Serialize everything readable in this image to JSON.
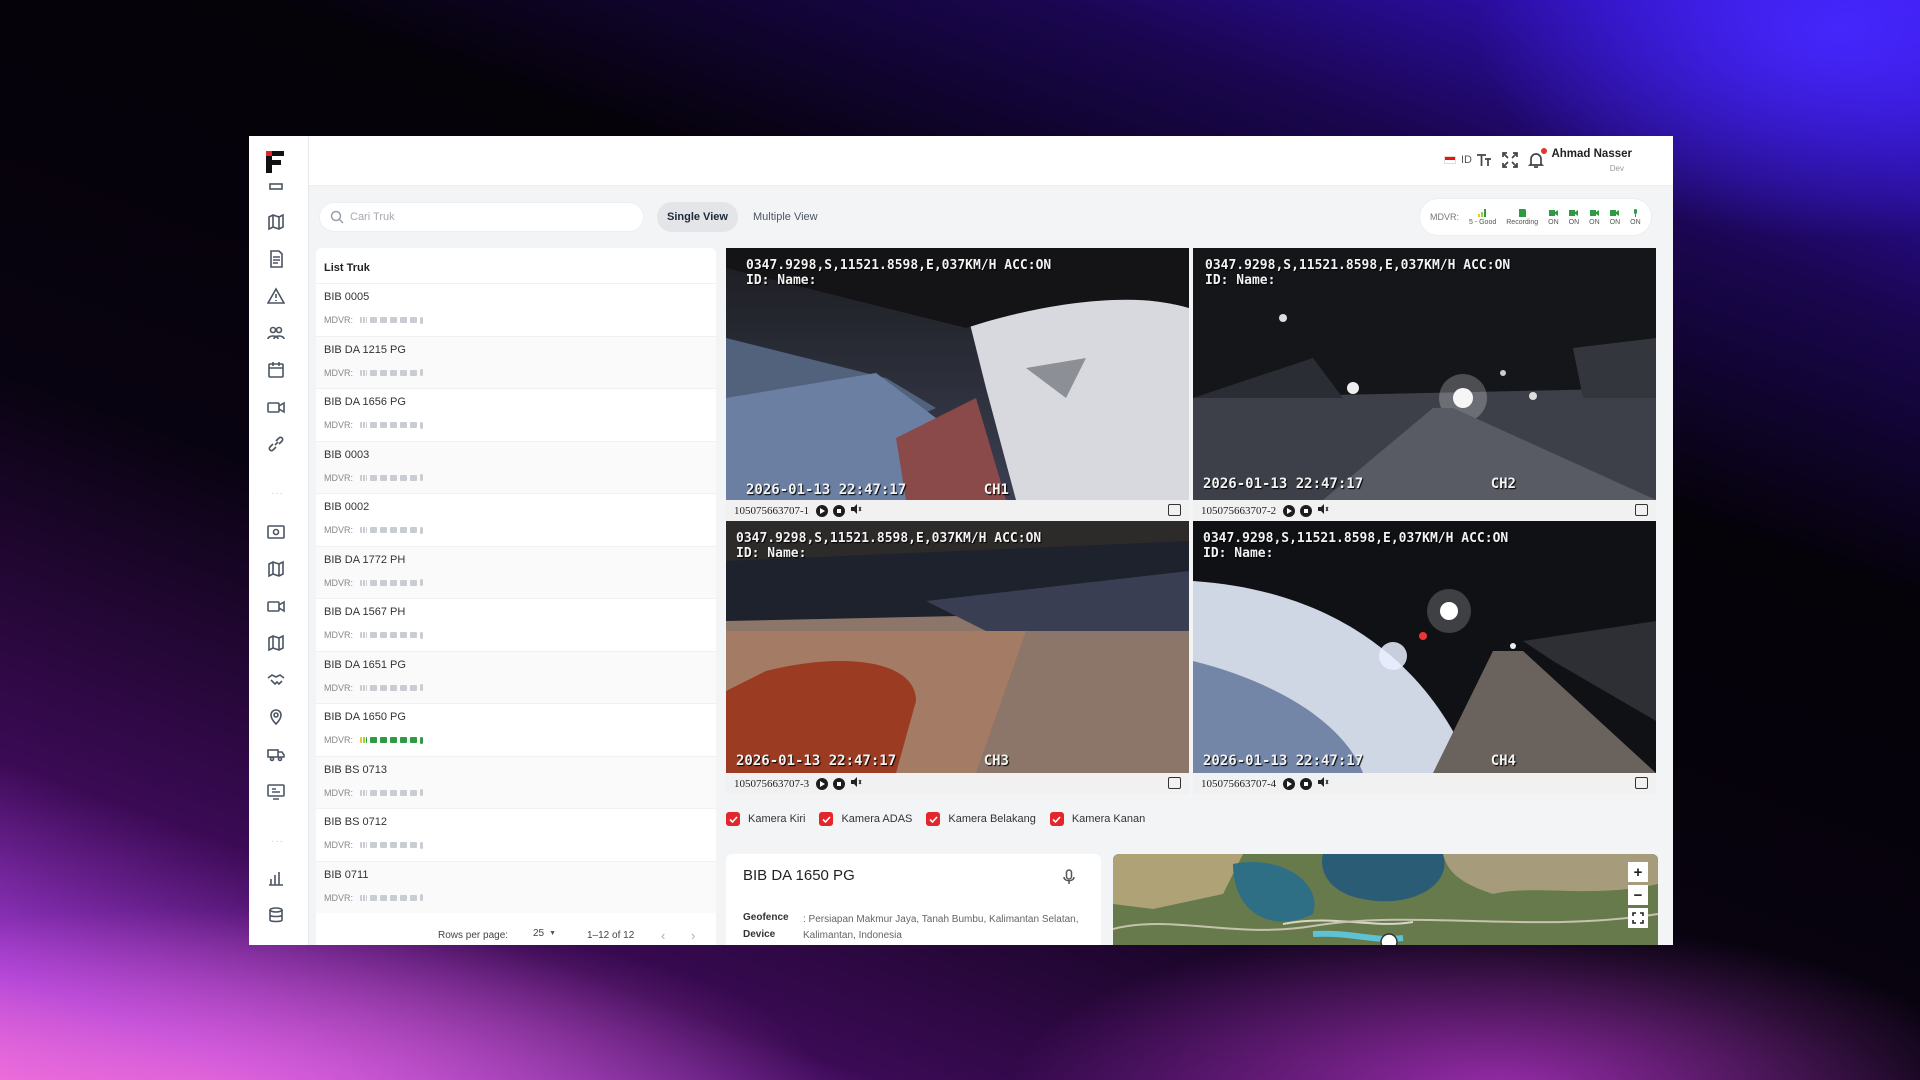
{
  "topbar": {
    "language": "ID",
    "user_name": "Ahmad Nasser",
    "user_role": "Dev"
  },
  "search": {
    "placeholder": "Cari Truk"
  },
  "views": {
    "single": "Single View",
    "multiple": "Multiple View"
  },
  "mdvr_status": {
    "label": "MDVR:",
    "items": [
      "5 - Good",
      "Recording",
      "ON",
      "ON",
      "ON",
      "ON",
      "ON"
    ]
  },
  "truck_list": {
    "title": "List Truk",
    "mdvr_label": "MDVR:",
    "items": [
      {
        "name": "BIB 0005",
        "active": false
      },
      {
        "name": "BIB DA 1215 PG",
        "active": false
      },
      {
        "name": "BIB DA 1656 PG",
        "active": false
      },
      {
        "name": "BIB 0003",
        "active": false
      },
      {
        "name": "BIB 0002",
        "active": false
      },
      {
        "name": "BIB DA 1772 PH",
        "active": false
      },
      {
        "name": "BIB DA 1567 PH",
        "active": false
      },
      {
        "name": "BIB DA 1651 PG",
        "active": false
      },
      {
        "name": "BIB DA 1650 PG",
        "active": true
      },
      {
        "name": "BIB BS 0713",
        "active": false
      },
      {
        "name": "BIB BS 0712",
        "active": false
      },
      {
        "name": "BIB 0711",
        "active": false
      }
    ],
    "pager": {
      "rows_label": "Rows per page:",
      "rows_value": "25",
      "range": "1–12 of 12"
    }
  },
  "videos": [
    {
      "osd": "0347.9298,S,11521.8598,E,037KM/H ACC:ON\nID: Name:",
      "timestamp": "2026-01-13 22:47:17",
      "channel": "CH1",
      "device": "105075663707-1"
    },
    {
      "osd": "0347.9298,S,11521.8598,E,037KM/H ACC:ON\nID: Name:",
      "timestamp": "2026-01-13 22:47:17",
      "channel": "CH2",
      "device": "105075663707-2"
    },
    {
      "osd": "0347.9298,S,11521.8598,E,037KM/H ACC:ON\nID: Name:",
      "timestamp": "2026-01-13 22:47:17",
      "channel": "CH3",
      "device": "105075663707-3"
    },
    {
      "osd": "0347.9298,S,11521.8598,E,037KM/H ACC:ON\nID: Name:",
      "timestamp": "2026-01-13 22:47:17",
      "channel": "CH4",
      "device": "105075663707-4"
    }
  ],
  "camera_toggles": [
    "Kamera Kiri",
    "Kamera ADAS",
    "Kamera Belakang",
    "Kamera Kanan"
  ],
  "info": {
    "title": "BIB DA 1650 PG",
    "geofence_label": "Geofence",
    "geofence_value": ": Persiapan Makmur Jaya, Tanah Bumbu, Kalimantan Selatan, Kalimantan, Indonesia",
    "device_label": "Device"
  },
  "map": {
    "zoom_in": "+",
    "zoom_out": "−"
  },
  "colors": {
    "brand": "#e8302a",
    "active": "#2e9b42"
  }
}
